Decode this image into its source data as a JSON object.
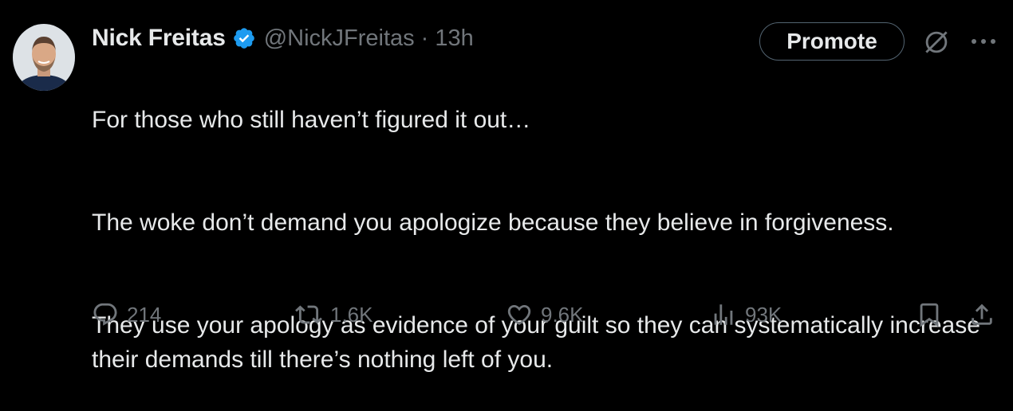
{
  "tweet": {
    "author": {
      "display_name": "Nick Freitas",
      "verified": true,
      "handle": "@NickJFreitas",
      "separator": "·",
      "time": "13h",
      "avatar_icon": "profile-photo"
    },
    "header_actions": {
      "promote_label": "Promote",
      "grok_icon": "grok-icon",
      "more_icon": "more-dots-icon"
    },
    "text": {
      "line1": "For those who still haven’t figured it out…",
      "line2": "The woke don’t demand you apologize because they believe in forgiveness.",
      "line3": "They use your apology as evidence of your guilt so they can systematically increase their demands till there’s nothing left of you."
    },
    "stats": {
      "replies": "214",
      "reposts": "1.6K",
      "likes": "9.6K",
      "views": "93K"
    },
    "colors": {
      "background": "#000000",
      "text": "#e7e9ea",
      "muted": "#71767b",
      "verified_blue": "#1d9bf0",
      "border": "#536471"
    }
  }
}
